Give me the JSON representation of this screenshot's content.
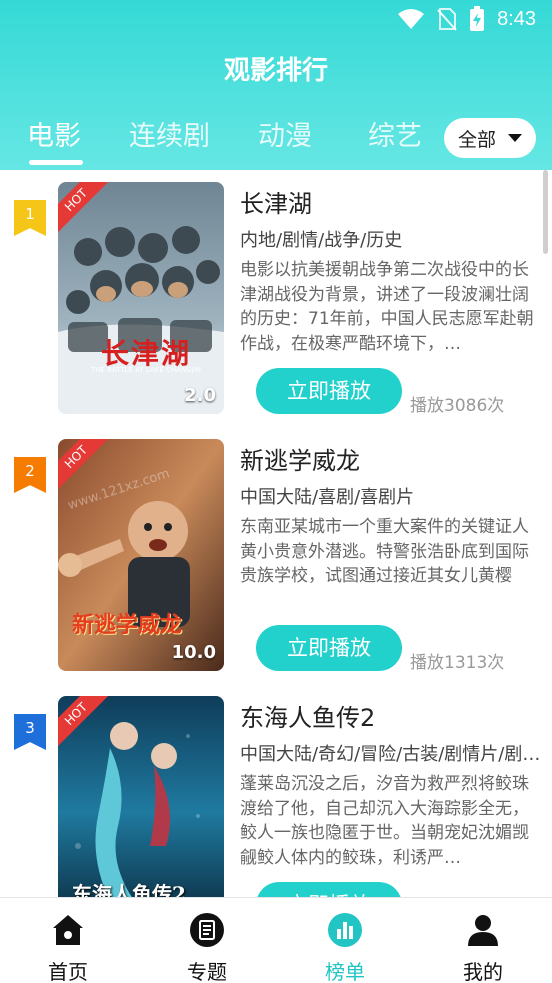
{
  "status": {
    "time": "8:43"
  },
  "header": {
    "title": "观影排行"
  },
  "tabs": [
    {
      "label": "电影"
    },
    {
      "label": "连续剧"
    },
    {
      "label": "动漫"
    },
    {
      "label": "综艺"
    }
  ],
  "filter": {
    "label": "全部"
  },
  "items": [
    {
      "rank": "1",
      "rank_color": "#f5c518",
      "title": "长津湖",
      "genre": "内地/剧情/战争/历史",
      "desc": "电影以抗美援朝战争第二次战役中的长津湖战役为背景，讲述了一段波澜壮阔的历史：71年前，中国人民志愿军赴朝作战，在极寒严酷环境下，…",
      "score": "2.0",
      "hot": "HOT",
      "poster_text": "长津湖",
      "poster_subtext": "THE BATTLE AT LAKE CHANGJIN",
      "play_label": "立即播放",
      "plays": "播放3086次"
    },
    {
      "rank": "2",
      "rank_color": "#f57c00",
      "title": "新逃学威龙",
      "genre": "中国大陆/喜剧/喜剧片",
      "desc": "东南亚某城市一个重大案件的关键证人黄小贵意外潜逃。特警张浩卧底到国际贵族学校，试图通过接近其女儿黄樱",
      "score": "10.0",
      "hot": "HOT",
      "poster_text": "新逃学威龙",
      "watermark": "www.121xz.com",
      "play_label": "立即播放",
      "plays": "播放1313次"
    },
    {
      "rank": "3",
      "rank_color": "#1e6fd9",
      "title": "东海人鱼传2",
      "genre": "中国大陆/奇幻/冒险/古装/剧情片/剧…",
      "desc": "蓬莱岛沉没之后，汐音为救严烈将鲛珠渡给了他，自己却沉入大海踪影全无，鲛人一族也隐匿于世。当朝宠妃沈媚觊觎鲛人体内的鲛珠，利诱严…",
      "score": "",
      "hot": "HOT",
      "poster_text": "东海人鱼传2",
      "play_label": "立即播放",
      "plays": ""
    }
  ],
  "nav": [
    {
      "label": "首页",
      "icon": "home-icon"
    },
    {
      "label": "专题",
      "icon": "topic-icon"
    },
    {
      "label": "榜单",
      "icon": "ranking-icon"
    },
    {
      "label": "我的",
      "icon": "profile-icon"
    }
  ],
  "colors": {
    "accent": "#22d1cb",
    "header_top": "#35d9d6",
    "nav_active": "#22c4c4"
  }
}
